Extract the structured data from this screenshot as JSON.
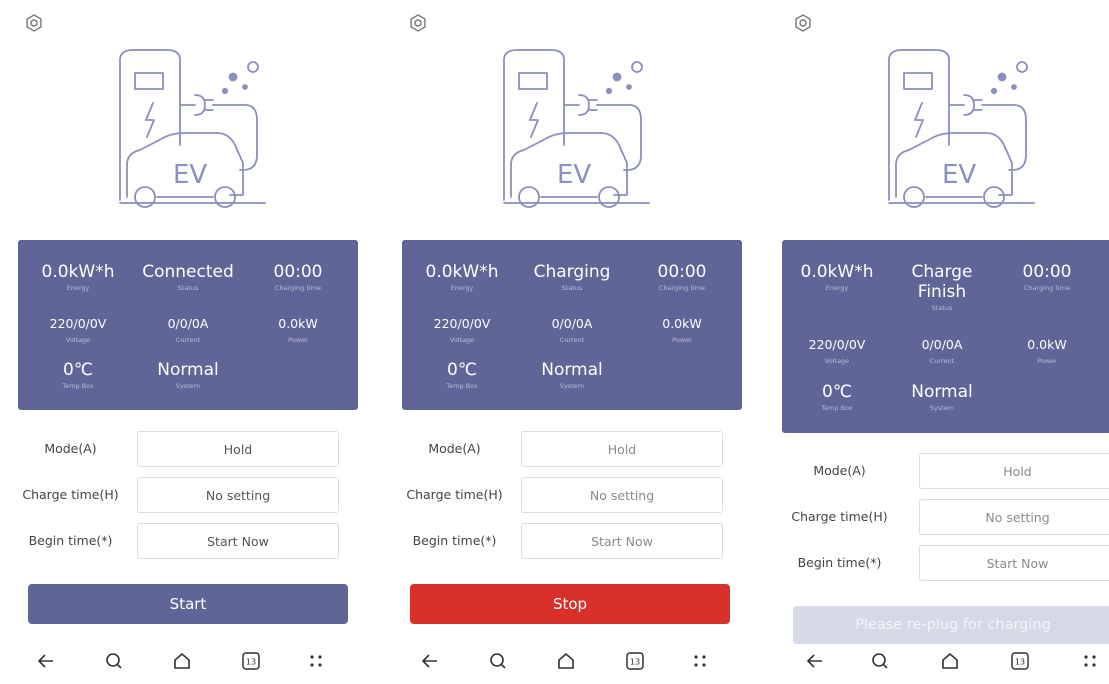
{
  "screens": [
    {
      "stats": {
        "energy": {
          "value": "0.0kW*h",
          "label": "Energy"
        },
        "status": {
          "value": "Connected",
          "label": "Status"
        },
        "charging_time": {
          "value": "00:00",
          "label": "Charging time"
        },
        "voltage": {
          "value": "220/0/0V",
          "label": "Voltage"
        },
        "current": {
          "value": "0/0/0A",
          "label": "Current"
        },
        "power": {
          "value": "0.0kW",
          "label": "Power"
        },
        "temp": {
          "value": "0℃",
          "label": "Temp Box"
        },
        "system": {
          "value": "Normal",
          "label": "System"
        }
      },
      "form": {
        "mode_label": "Mode(A)",
        "mode_value": "Hold",
        "charge_time_label": "Charge time(H)",
        "charge_time_value": "No setting",
        "begin_time_label": "Begin time(*)",
        "begin_time_value": "Start Now"
      },
      "action": {
        "label": "Start",
        "color": "#5f6596"
      }
    },
    {
      "stats": {
        "energy": {
          "value": "0.0kW*h",
          "label": "Energy"
        },
        "status": {
          "value": "Charging",
          "label": "Status"
        },
        "charging_time": {
          "value": "00:00",
          "label": "Charging time"
        },
        "voltage": {
          "value": "220/0/0V",
          "label": "Voltage"
        },
        "current": {
          "value": "0/0/0A",
          "label": "Current"
        },
        "power": {
          "value": "0.0kW",
          "label": "Power"
        },
        "temp": {
          "value": "0℃",
          "label": "Temp Box"
        },
        "system": {
          "value": "Normal",
          "label": "System"
        }
      },
      "form": {
        "mode_label": "Mode(A)",
        "mode_value": "Hold",
        "charge_time_label": "Charge time(H)",
        "charge_time_value": "No setting",
        "begin_time_label": "Begin time(*)",
        "begin_time_value": "Start Now"
      },
      "action": {
        "label": "Stop",
        "color": "#d9302a"
      }
    },
    {
      "stats": {
        "energy": {
          "value": "0.0kW*h",
          "label": "Energy"
        },
        "status": {
          "value": "Charge Finish",
          "label": "Status"
        },
        "charging_time": {
          "value": "00:00",
          "label": "Charging time"
        },
        "voltage": {
          "value": "220/0/0V",
          "label": "Voltage"
        },
        "current": {
          "value": "0/0/0A",
          "label": "Current"
        },
        "power": {
          "value": "0.0kW",
          "label": "Power"
        },
        "temp": {
          "value": "0℃",
          "label": "Temp Box"
        },
        "system": {
          "value": "Normal",
          "label": "System"
        }
      },
      "form": {
        "mode_label": "Mode(A)",
        "mode_value": "Hold",
        "charge_time_label": "Charge time(H)",
        "charge_time_value": "No setting",
        "begin_time_label": "Begin time(*)",
        "begin_time_value": "Start Now"
      },
      "action": {
        "label": "Please re-plug for charging",
        "color": "#d5d8e6"
      }
    }
  ],
  "illustration": {
    "label": "EV"
  },
  "nav": {
    "badge": "13"
  },
  "icons": [
    "settings-icon",
    "back-arrow-icon",
    "search-icon",
    "home-icon",
    "tabs-icon",
    "menu-dots-icon"
  ],
  "colors": {
    "panel": "#5f6596",
    "start": "#5f6596",
    "stop": "#d9302a",
    "disabled": "#d5d8e6",
    "line": "#8a8fbd"
  }
}
